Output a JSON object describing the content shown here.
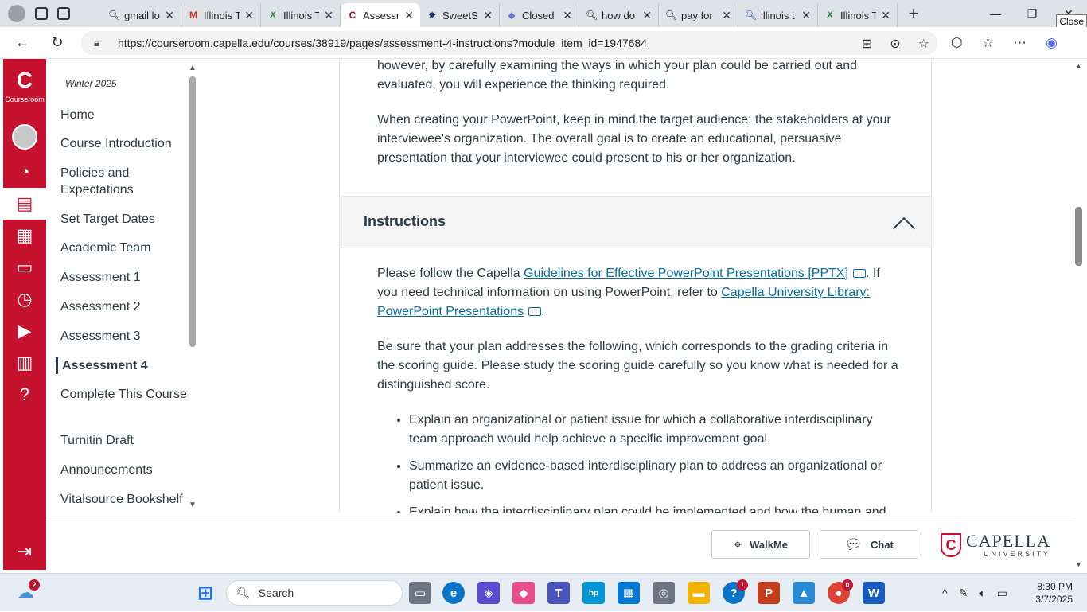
{
  "browser": {
    "tabs": [
      {
        "title": "gmail lo",
        "icon": "search-icon"
      },
      {
        "title": "Illinois T",
        "icon": "gmail-icon"
      },
      {
        "title": "Illinois T",
        "icon": "sheet-icon"
      },
      {
        "title": "Assessm",
        "icon": "capella-icon",
        "active": true
      },
      {
        "title": "SweetSt",
        "icon": "star-icon"
      },
      {
        "title": "Closed",
        "icon": "closed-icon"
      },
      {
        "title": "how do",
        "icon": "search-icon"
      },
      {
        "title": "pay for",
        "icon": "search-icon"
      },
      {
        "title": "illinois t",
        "icon": "search-icon"
      },
      {
        "title": "Illinois T",
        "icon": "sheet-icon"
      }
    ],
    "close_tooltip": "Close",
    "url": "https://courseroom.capella.edu/courses/38919/pages/assessment-4-instructions?module_item_id=1947684"
  },
  "rail": {
    "logo_label": "Courseroom",
    "accent": "#c4122f"
  },
  "coursenav": {
    "term": "Winter 2025",
    "items": [
      "Home",
      "Course Introduction",
      "Policies and Expectations",
      "Set Target Dates",
      "Academic Team",
      "Assessment 1",
      "Assessment 2",
      "Assessment 3",
      "Assessment 4",
      "Complete This Course",
      "Turnitin Draft",
      "Announcements",
      "Vitalsource Bookshelf"
    ],
    "current": "Assessment 4"
  },
  "content": {
    "p1": "however, by carefully examining the ways in which your plan could be carried out and evaluated, you will experience the thinking required.",
    "p2": "When creating your PowerPoint, keep in mind the target audience: the stakeholders at your interviewee's organization. The overall goal is to create an educational, persuasive presentation that your interviewee could present to his or her organization.",
    "section_title": "Instructions",
    "p3_pre": "Please follow the Capella ",
    "p3_link1": "Guidelines for Effective PowerPoint Presentations [PPTX]",
    "p3_mid": ". If you need technical information on using PowerPoint, refer to ",
    "p3_link2": "Capella University Library: PowerPoint Presentations",
    "p3_post": ".",
    "p4": "Be sure that your plan addresses the following, which corresponds to the grading criteria in the scoring guide. Please study the scoring guide carefully so you know what is needed for a distinguished score.",
    "bullets": [
      "Explain an organizational or patient issue for which a collaborative interdisciplinary team approach would help achieve a specific improvement goal.",
      "Summarize an evidence-based interdisciplinary plan to address an organizational or patient issue.",
      "Explain how the interdisciplinary plan could be implemented and how the human and"
    ]
  },
  "footer": {
    "walkme_label": "WalkMe",
    "chat_label": "Chat",
    "logo_name": "CAPELLA",
    "logo_sub": "UNIVERSITY"
  },
  "taskbar": {
    "weather_badge": "2",
    "search_placeholder": "Search",
    "time": "8:30 PM",
    "date": "3/7/2025",
    "chrome_badge": "0",
    "help_badge": "!"
  }
}
